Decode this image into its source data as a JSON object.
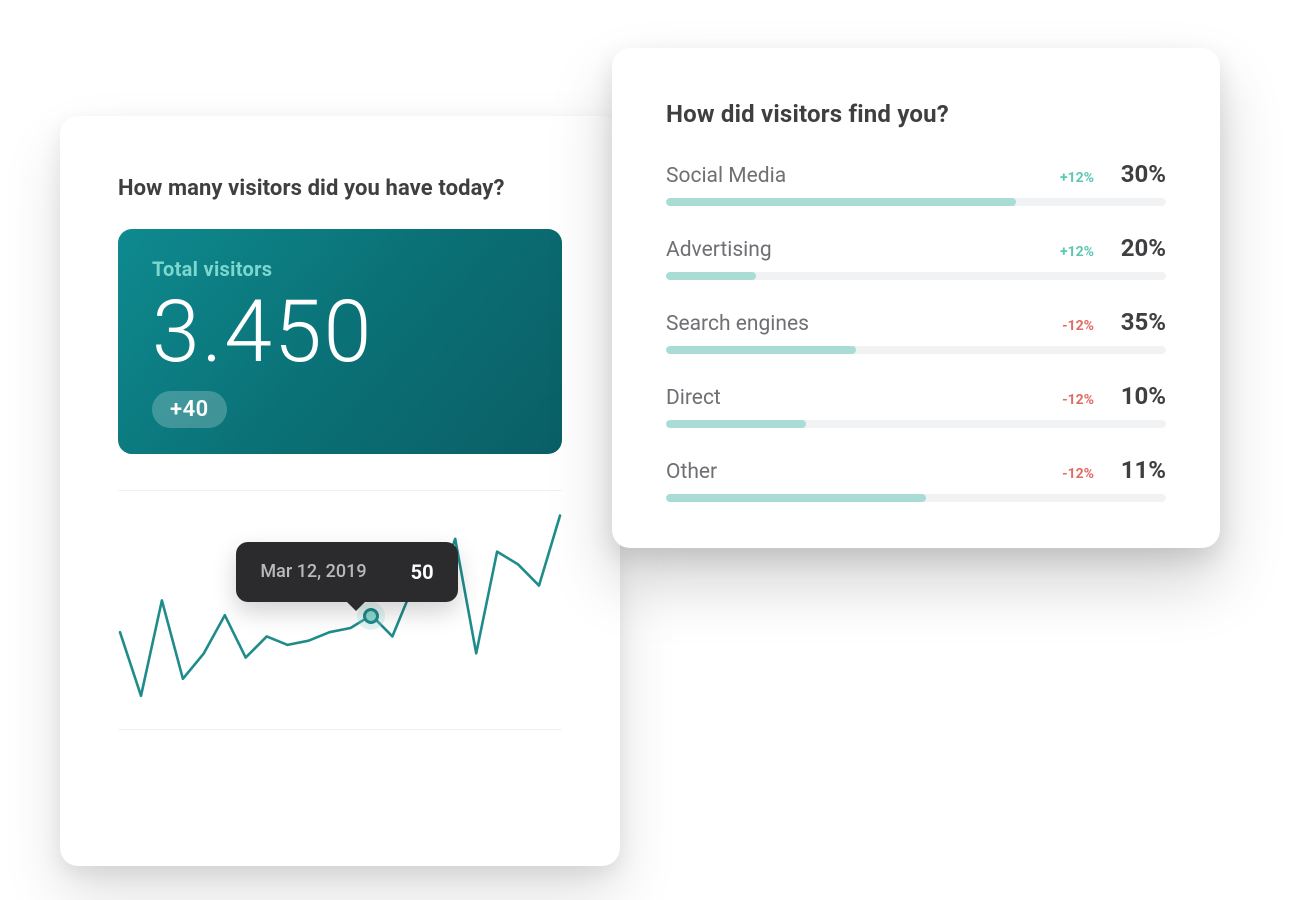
{
  "visitors_card": {
    "title": "How many visitors did you have today?",
    "total_label": "Total visitors",
    "total_value": "3.450",
    "total_delta": "+40",
    "tooltip": {
      "date": "Mar 12, 2019",
      "value": "50"
    }
  },
  "sources_card": {
    "title": "How did visitors find you?",
    "rows": [
      {
        "label": "Social Media",
        "delta": "+12%",
        "dir": "up",
        "value": "30%",
        "bar": 70
      },
      {
        "label": "Advertising",
        "delta": "+12%",
        "dir": "up",
        "value": "20%",
        "bar": 18
      },
      {
        "label": "Search engines",
        "delta": "-12%",
        "dir": "down",
        "value": "35%",
        "bar": 38
      },
      {
        "label": "Direct",
        "delta": "-12%",
        "dir": "down",
        "value": "10%",
        "bar": 28
      },
      {
        "label": "Other",
        "delta": "-12%",
        "dir": "down",
        "value": "11%",
        "bar": 52
      }
    ]
  },
  "chart_data": {
    "type": "line",
    "title": "",
    "xlabel": "",
    "ylabel": "",
    "ylim": [
      0,
      100
    ],
    "x": [
      0,
      1,
      2,
      3,
      4,
      5,
      6,
      7,
      8,
      9,
      10,
      11,
      12,
      13,
      14,
      15,
      16,
      17,
      18,
      19,
      20,
      21
    ],
    "values": [
      40,
      10,
      55,
      18,
      30,
      48,
      28,
      38,
      34,
      36,
      40,
      42,
      48,
      38,
      62,
      56,
      84,
      30,
      78,
      72,
      62,
      95
    ],
    "highlight": {
      "index": 12,
      "label": "Mar 12, 2019",
      "value": 50
    }
  }
}
